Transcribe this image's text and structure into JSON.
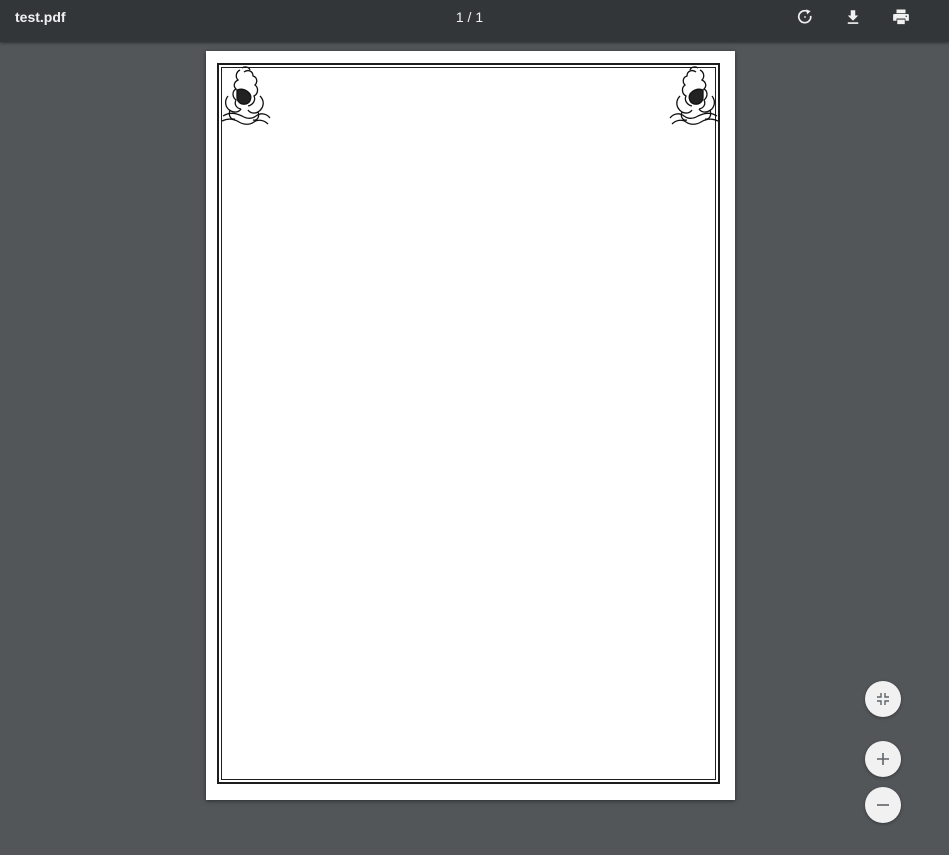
{
  "toolbar": {
    "file_name": "test.pdf",
    "page_indicator": "1 / 1",
    "buttons": [
      {
        "name": "rotate",
        "icon": "rotate-icon"
      },
      {
        "name": "download",
        "icon": "download-icon"
      },
      {
        "name": "print",
        "icon": "print-icon"
      }
    ]
  },
  "zoom_controls": [
    {
      "name": "fit-to-page",
      "icon": "fit-page-icon"
    },
    {
      "name": "zoom-in",
      "icon": "plus-icon"
    },
    {
      "name": "zoom-out",
      "icon": "minus-icon"
    }
  ],
  "colors": {
    "toolbar_bg": "#323639",
    "viewer_bg": "#525659",
    "page_bg": "#ffffff",
    "border": "#1d1d1d",
    "fab_bg": "#f1f1f1"
  }
}
